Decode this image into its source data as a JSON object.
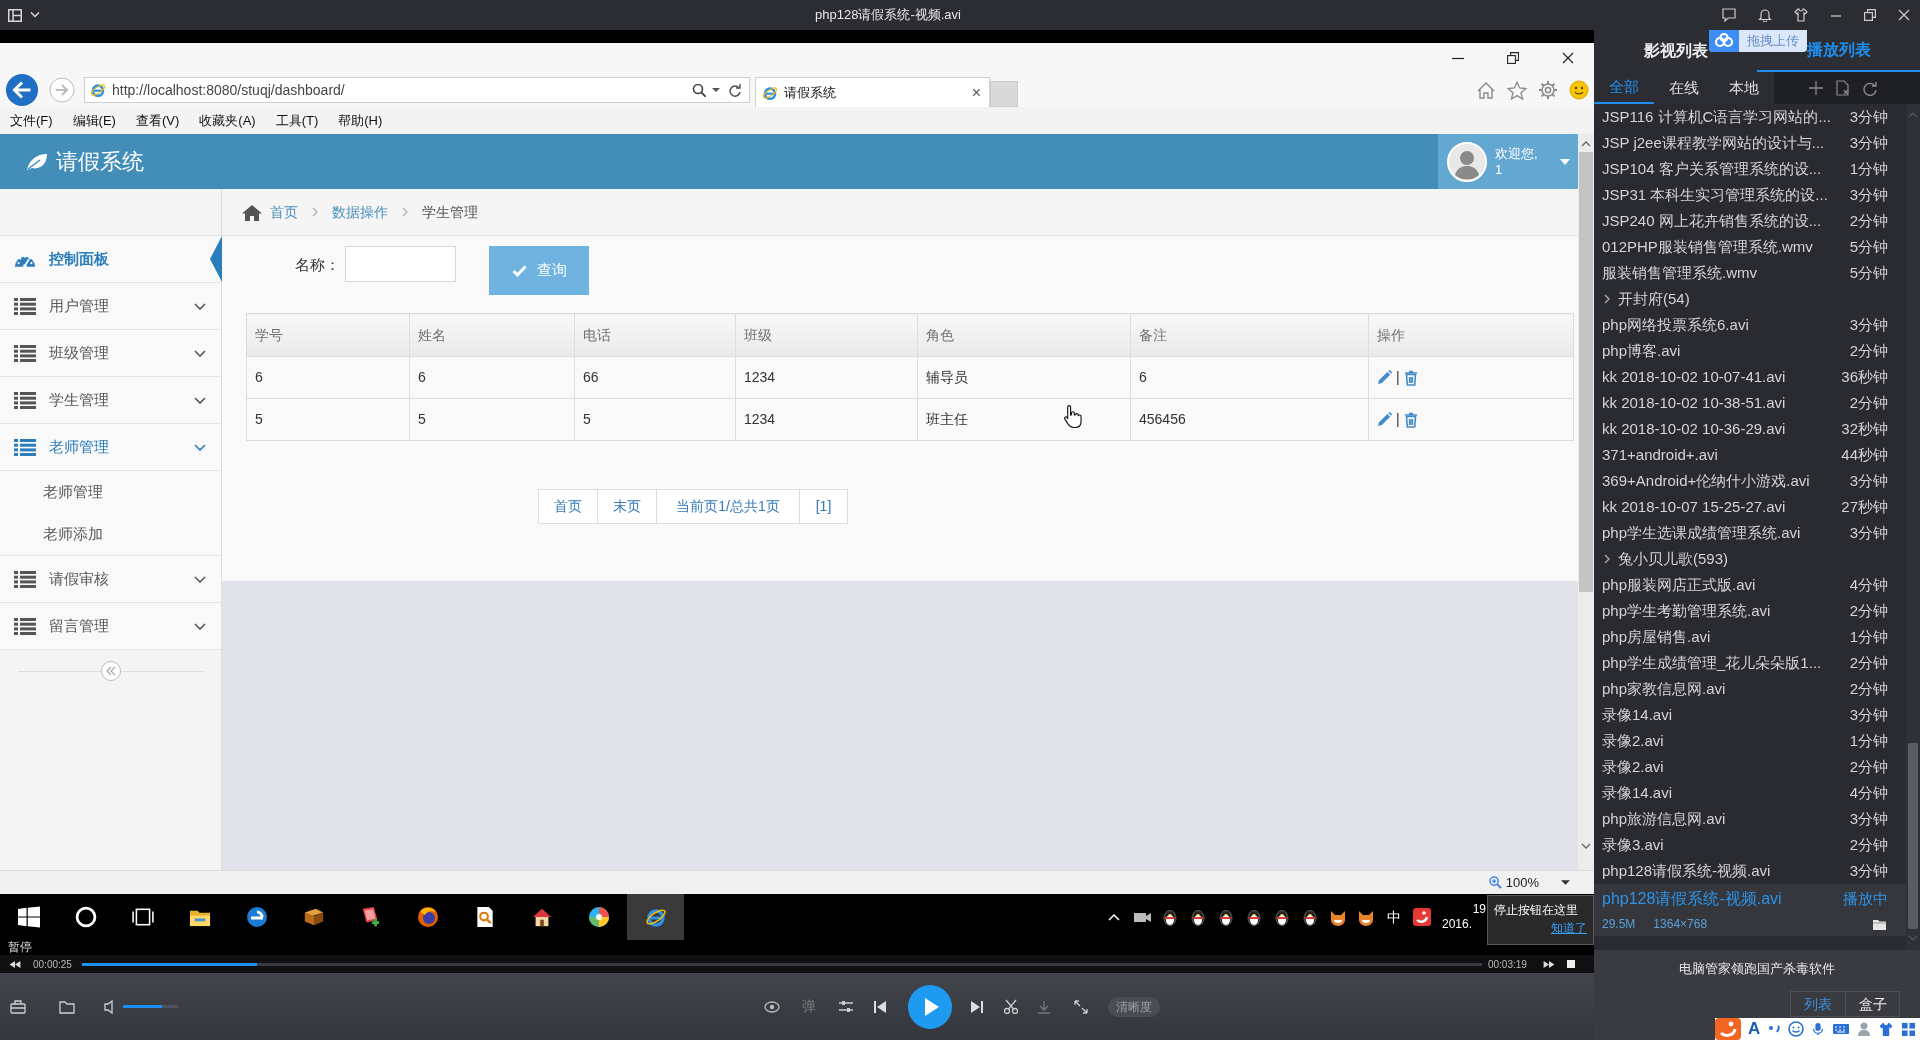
{
  "player": {
    "title": "php128请假系统-视频.avi",
    "status": "暂停",
    "elapsed": "00:00:25",
    "duration": "00:03:19",
    "progress": {
      "level": 0.125
    },
    "volume": {
      "level": 0.7
    },
    "danmaku": "弹",
    "quality": "清晰度"
  },
  "browser": {
    "url": "http://localhost:8080/stuqj/dashboard/",
    "tab": {
      "title": "请假系统",
      "close": "×"
    },
    "menu": [
      "文件(F)",
      "编辑(E)",
      "查看(V)",
      "收藏夹(A)",
      "工具(T)",
      "帮助(H)"
    ],
    "zoom": "100%"
  },
  "app": {
    "brand": "请假系统",
    "user": {
      "greeting": "欢迎您,",
      "name": "1"
    },
    "sidebar": [
      {
        "label": "控制面板",
        "kind": "dashboard",
        "selected": true,
        "expanded": false
      },
      {
        "label": "用户管理",
        "kind": "list",
        "selected": false,
        "expanded": false
      },
      {
        "label": "班级管理",
        "kind": "list",
        "selected": false,
        "expanded": false
      },
      {
        "label": "学生管理",
        "kind": "list",
        "selected": false,
        "expanded": false
      },
      {
        "label": "老师管理",
        "kind": "list",
        "selected": false,
        "expanded": true,
        "children": [
          {
            "label": "老师管理",
            "selected": false
          },
          {
            "label": "老师添加",
            "selected": false
          }
        ]
      },
      {
        "label": "请假审核",
        "kind": "list",
        "selected": false,
        "expanded": false
      },
      {
        "label": "留言管理",
        "kind": "list",
        "selected": false,
        "expanded": false
      }
    ],
    "breadcrumb": [
      {
        "label": "首页",
        "kind": "home"
      },
      {
        "label": "数据操作",
        "kind": "link"
      },
      {
        "label": "学生管理",
        "kind": "current"
      }
    ],
    "search": {
      "label": "名称："
    },
    "query_button": "查询",
    "table": {
      "columns": [
        "学号",
        "姓名",
        "电话",
        "班级",
        "角色",
        "备注",
        "操作"
      ],
      "rows": [
        {
          "cells": [
            "6",
            "6",
            "66",
            "1234",
            "辅导员",
            "6"
          ],
          "separator": "|"
        },
        {
          "cells": [
            "5",
            "5",
            "5",
            "1234",
            "班主任",
            "456456"
          ],
          "separator": "|"
        }
      ]
    },
    "pagination": [
      "首页",
      "末页",
      "当前页1/总共1页",
      "[1]"
    ]
  },
  "taskbar": {
    "apps": [
      {
        "kind": "start",
        "active": false
      },
      {
        "kind": "search",
        "active": false
      },
      {
        "kind": "task-view",
        "active": false
      },
      {
        "kind": "folder",
        "active": false
      },
      {
        "kind": "edge",
        "active": false
      },
      {
        "kind": "book",
        "active": false
      },
      {
        "kind": "notes",
        "active": false
      },
      {
        "kind": "firefox",
        "active": false
      },
      {
        "kind": "doc-viewer",
        "active": false
      },
      {
        "kind": "house",
        "active": false
      },
      {
        "kind": "pinwheel",
        "active": false
      },
      {
        "kind": "ie",
        "active": true
      }
    ],
    "tray": [
      {
        "kind": "chevron"
      },
      {
        "kind": "camera"
      },
      {
        "kind": "penguin"
      },
      {
        "kind": "penguin"
      },
      {
        "kind": "penguin"
      },
      {
        "kind": "penguin"
      },
      {
        "kind": "penguin"
      },
      {
        "kind": "penguin"
      },
      {
        "kind": "fox"
      },
      {
        "kind": "fox"
      },
      {
        "kind": "input-mode",
        "text": "中"
      },
      {
        "kind": "sogou"
      }
    ],
    "clock": [
      "19",
      "2016."
    ]
  },
  "tooltip": {
    "text": "停止按钮在这里",
    "link": "知道了"
  },
  "playlist": {
    "tabs": [
      {
        "label": "影视列表",
        "selected": false
      },
      {
        "label": "播放列表",
        "selected": true
      }
    ],
    "upload_hint": "拖拽上传",
    "filters": [
      {
        "label": "全部",
        "selected": true
      },
      {
        "label": "在线",
        "selected": false
      },
      {
        "label": "本地",
        "selected": false
      }
    ],
    "items": [
      {
        "kind": "video",
        "title": "JSP116 计算机C语言学习网站的...",
        "duration": "3分钟",
        "selected": false
      },
      {
        "kind": "video",
        "title": "JSP j2ee课程教学网站的设计与...",
        "duration": "3分钟",
        "selected": false
      },
      {
        "kind": "video",
        "title": "JSP104 客户关系管理系统的设...",
        "duration": "1分钟",
        "selected": false
      },
      {
        "kind": "video",
        "title": "JSP31 本科生实习管理系统的设...",
        "duration": "3分钟",
        "selected": false
      },
      {
        "kind": "video",
        "title": "JSP240 网上花卉销售系统的设...",
        "duration": "2分钟",
        "selected": false
      },
      {
        "kind": "video",
        "title": "012PHP服装销售管理系统.wmv",
        "duration": "5分钟",
        "selected": false
      },
      {
        "kind": "video",
        "title": "服装销售管理系统.wmv",
        "duration": "5分钟",
        "selected": false
      },
      {
        "kind": "folder",
        "title": "开封府(54)",
        "expanded": false,
        "selected": false
      },
      {
        "kind": "video",
        "title": "php网络投票系统6.avi",
        "duration": "3分钟",
        "selected": false
      },
      {
        "kind": "video",
        "title": "php博客.avi",
        "duration": "2分钟",
        "selected": false
      },
      {
        "kind": "video",
        "title": "kk 2018-10-02 10-07-41.avi",
        "duration": "36秒钟",
        "selected": false
      },
      {
        "kind": "video",
        "title": "kk 2018-10-02 10-38-51.avi",
        "duration": "2分钟",
        "selected": false
      },
      {
        "kind": "video",
        "title": "kk 2018-10-02 10-36-29.avi",
        "duration": "32秒钟",
        "selected": false
      },
      {
        "kind": "video",
        "title": "371+android+.avi",
        "duration": "44秒钟",
        "selected": false
      },
      {
        "kind": "video",
        "title": "369+Android+伦纳什小游戏.avi",
        "duration": "3分钟",
        "selected": false
      },
      {
        "kind": "video",
        "title": "kk 2018-10-07 15-25-27.avi",
        "duration": "27秒钟",
        "selected": false
      },
      {
        "kind": "video",
        "title": "php学生选课成绩管理系统.avi",
        "duration": "3分钟",
        "selected": false
      },
      {
        "kind": "folder",
        "title": "兔小贝儿歌(593)",
        "expanded": false,
        "selected": false
      },
      {
        "kind": "video",
        "title": "php服装网店正式版.avi",
        "duration": "4分钟",
        "selected": false
      },
      {
        "kind": "video",
        "title": "php学生考勤管理系统.avi",
        "duration": "2分钟",
        "selected": false
      },
      {
        "kind": "video",
        "title": "php房屋销售.avi",
        "duration": "1分钟",
        "selected": false
      },
      {
        "kind": "video",
        "title": "php学生成绩管理_花儿朵朵版1...",
        "duration": "2分钟",
        "selected": false
      },
      {
        "kind": "video",
        "title": "php家教信息网.avi",
        "duration": "2分钟",
        "selected": false
      },
      {
        "kind": "video",
        "title": "录像14.avi",
        "duration": "3分钟",
        "selected": false
      },
      {
        "kind": "video",
        "title": "录像2.avi",
        "duration": "1分钟",
        "selected": false
      },
      {
        "kind": "video",
        "title": "录像2.avi",
        "duration": "2分钟",
        "selected": false
      },
      {
        "kind": "video",
        "title": "录像14.avi",
        "duration": "4分钟",
        "selected": false
      },
      {
        "kind": "video",
        "title": "php旅游信息网.avi",
        "duration": "3分钟",
        "selected": false
      },
      {
        "kind": "video",
        "title": "录像3.avi",
        "duration": "2分钟",
        "selected": false
      },
      {
        "kind": "video",
        "title": "php128请假系统-视频.avi",
        "duration": "3分钟",
        "selected": false
      },
      {
        "kind": "video",
        "title": "php128请假系统-视频.avi",
        "duration": "播放中",
        "selected": true,
        "size": "29.5M",
        "resolution": "1364×768"
      }
    ],
    "ad": "电脑管家领跑国产杀毒软件",
    "views": [
      {
        "label": "列表",
        "selected": true
      },
      {
        "label": "盒子",
        "selected": false
      }
    ]
  },
  "ime_bar": {
    "mode": "A"
  }
}
